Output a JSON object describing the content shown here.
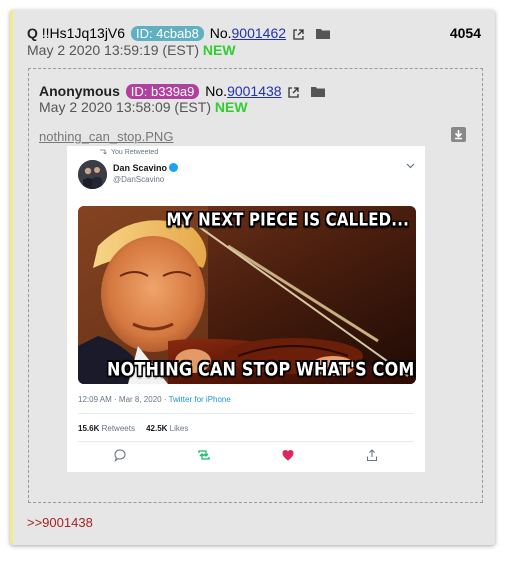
{
  "post": {
    "name": "Q",
    "tripcode": "!!Hs1Jq13jV6",
    "id_label": "ID: 4cbab8",
    "id_color": "#5fb0c0",
    "no_prefix": "No.",
    "post_number": "9001462",
    "date": "May 2 2020 13:59:19 (EST)",
    "new_label": "NEW",
    "count": "4054",
    "backlink": ">>9001438"
  },
  "quoted": {
    "name": "Anonymous",
    "id_label": "ID: b339a9",
    "id_color": "#b040a0",
    "no_prefix": "No.",
    "post_number": "9001438",
    "date": "May 2 2020 13:58:09 (EST)",
    "new_label": "NEW",
    "filename": "nothing_can_stop.PNG"
  },
  "tweet": {
    "retweet_line": "You Retweeted",
    "display_name": "Dan Scavino",
    "handle": "@DanScavino",
    "meme_top": "MY NEXT PIECE IS CALLED...",
    "meme_bottom": "NOTHING CAN STOP WHAT'S COMING.",
    "timestamp": "12:09 AM · Mar 8, 2020 · ",
    "source": "Twitter for iPhone",
    "retweets_count": "15.6K",
    "retweets_label": "Retweets",
    "likes_count": "42.5K",
    "likes_label": "Likes"
  },
  "icons": [
    "external-link-icon",
    "folder-icon",
    "download-icon",
    "verified-icon",
    "chevron-down-icon",
    "reply-icon",
    "retweet-icon",
    "like-icon",
    "share-icon"
  ]
}
